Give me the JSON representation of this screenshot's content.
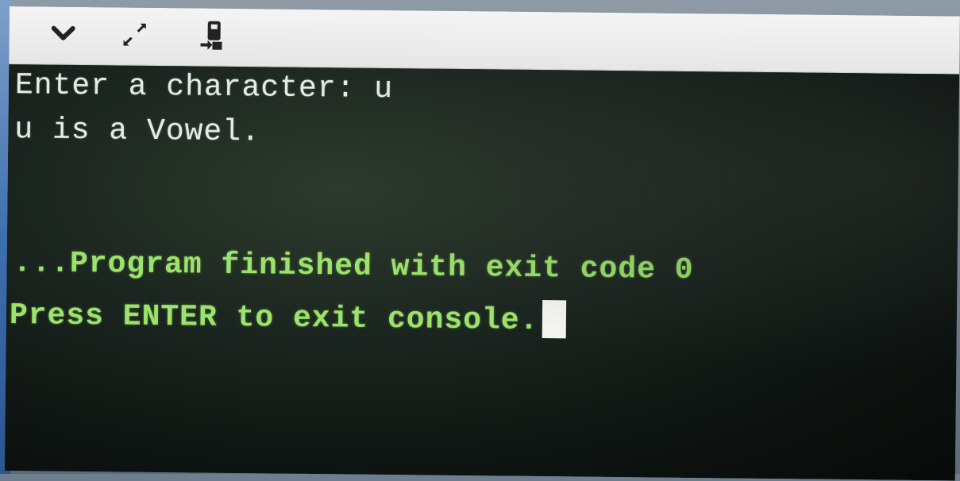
{
  "toolbar": {
    "icons": [
      {
        "name": "chevron-down-icon"
      },
      {
        "name": "expand-icon"
      },
      {
        "name": "stop-icon"
      }
    ]
  },
  "console": {
    "lines": [
      {
        "text": "Enter a character: u"
      },
      {
        "text": "u is a Vowel."
      },
      {
        "text": "...Program finished with exit code 0"
      },
      {
        "text": "Press ENTER to exit console."
      }
    ]
  },
  "colors": {
    "console_bg": "#0e1411",
    "output_text": "#e6ebe8",
    "status_text": "#9be36a",
    "toolbar_bg": "#eeeeee",
    "cursor": "#f5f5f0"
  }
}
